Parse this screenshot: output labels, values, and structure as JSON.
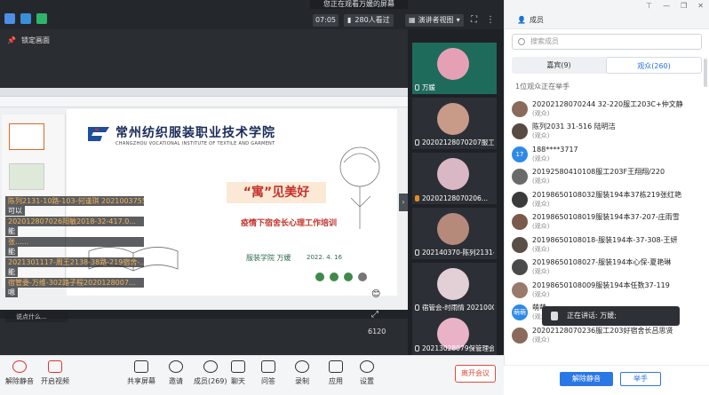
{
  "topbar": {
    "sharing_banner": "您正在观看万媛的屏幕",
    "timer": "07:05",
    "viewers": "280人看过",
    "view_mode": "演讲者视图",
    "lock_label": "锁定画面"
  },
  "slide": {
    "school_cn": "常州纺织服装职业技术学院",
    "school_en": "CHANGZHOU VOCATIONAL INSTITUTE OF TEXTILE AND GARMENT",
    "title": "“寓”见美好",
    "subtitle": "疫情下宿舍长心理工作培训",
    "dept": "服装学院  万媛",
    "date": "2022. 4. 16",
    "page_number": "6120"
  },
  "chat": [
    {
      "name": "陈列2131-10路-103-何谨琪 2021003755",
      "msg": "可以"
    },
    {
      "name": "202012807026阳敏2018-32-417.0...",
      "msg": "能"
    },
    {
      "name": "张......",
      "msg": "能"
    },
    {
      "name": "2021301117-周王2138-38路-219宿舍-...",
      "msg": "能"
    },
    {
      "name": "宿管委-万维-302路子程2020128007...",
      "msg": "嗯"
    }
  ],
  "chat_bottom": "说点什么...",
  "video_tiles": [
    {
      "label": "万媛",
      "active": true
    },
    {
      "label": "20202128070207服工2...",
      "active": false
    },
    {
      "label": "20202128070206...",
      "active": false
    },
    {
      "label": "202140370-陈列2131-1...",
      "active": false
    },
    {
      "label": "宿管会-时雨情 202100070",
      "active": false
    },
    {
      "label": "20213028079保管理会通...",
      "active": false
    }
  ],
  "panel": {
    "title": "成员",
    "search_placeholder": "搜索成员",
    "tab_guests": "嘉宾(9)",
    "tab_audience": "观众(260)",
    "raise_note": "1位观众正在举手",
    "speaking": "正在讲话: 万媛;",
    "btn_unmute": "解除静音",
    "btn_raise": "举手"
  },
  "members": [
    {
      "name": "20202128070244 32-220服工203C+仲文静",
      "role": "(观众)",
      "color": "#8a6a5a",
      "initial": ""
    },
    {
      "name": "陈列2031 31-516 陆明洁",
      "role": "(观众)",
      "color": "#5a4a44",
      "initial": ""
    },
    {
      "name": "188****3717",
      "role": "(观众)",
      "color": "#2f8ae6",
      "initial": "17"
    },
    {
      "name": "20192580410108服工203F王翔翔/220",
      "role": "(观众)",
      "color": "#6a6a6a",
      "initial": ""
    },
    {
      "name": "20198650108032服装194本37栋219张红艳",
      "role": "(观众)",
      "color": "#3a3a3a",
      "initial": ""
    },
    {
      "name": "20198650108019服装194本37-207-庄雨雪",
      "role": "(观众)",
      "color": "#7a5a4a",
      "initial": ""
    },
    {
      "name": "20198650108018-服装194本-37-308-王妍",
      "role": "(观众)",
      "color": "#5a4e48",
      "initial": ""
    },
    {
      "name": "20198650108027-服装194本心保-夏艳琳",
      "role": "(观众)",
      "color": "#4a4a4a",
      "initial": ""
    },
    {
      "name": "20198650108009服装194本任数37-119",
      "role": "(观众)",
      "color": "#9a7a6a",
      "initial": ""
    },
    {
      "name": "萌萌",
      "role": "(观众)",
      "color": "#2f8ae6",
      "initial": "萌萌"
    },
    {
      "name": "20202128070236服工203好宿舍长吕思贤",
      "role": "(观众)",
      "color": "#8a6a5a",
      "initial": ""
    }
  ],
  "toolbar": {
    "unmute": "解除静音",
    "start_video": "开启视频",
    "share_screen": "共享屏幕",
    "invite": "邀请",
    "members": "成员(269)",
    "chat": "聊天",
    "qa": "问答",
    "record": "录制",
    "apps": "应用",
    "settings": "设置",
    "leave": "离开会议"
  }
}
